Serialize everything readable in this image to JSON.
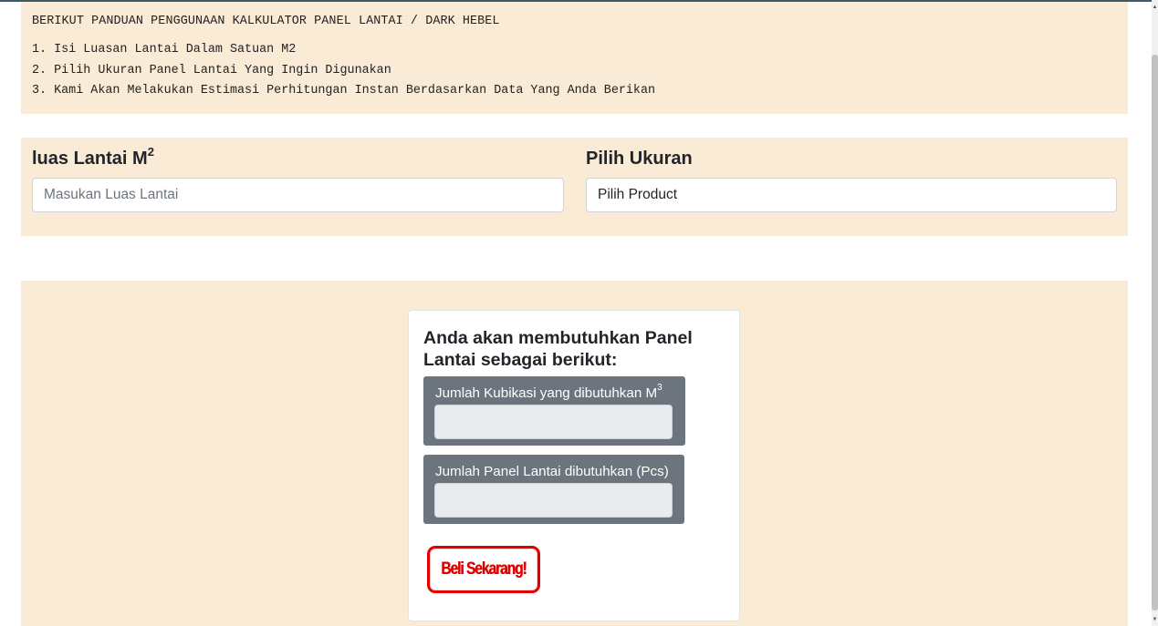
{
  "guide": {
    "title": "BERIKUT PANDUAN PENGGUNAAN KALKULATOR PANEL LANTAI / DARK HEBEL",
    "steps": [
      "1. Isi Luasan Lantai Dalam Satuan M2",
      "2. Pilih Ukuran Panel Lantai Yang Ingin Digunakan",
      "3. Kami Akan Melakukan Estimasi Perhitungan Instan Berdasarkan Data Yang Anda Berikan"
    ]
  },
  "form": {
    "area_label": "luas Lantai M",
    "area_label_sup": "2",
    "area_placeholder": "Masukan Luas Lantai",
    "area_value": "",
    "size_label": "Pilih Ukuran",
    "size_value": "Pilih Product"
  },
  "result": {
    "title": "Anda akan membutuhkan Panel Lantai sebagai berikut:",
    "volume_label": "Jumlah Kubikasi yang dibutuhkan M",
    "volume_label_sup": "3",
    "volume_value": "",
    "panels_label": "Jumlah Panel Lantai dibutuhkan (Pcs)",
    "panels_value": "",
    "buy_button": "Beli Sekarang!"
  },
  "colors": {
    "panel_bg": "#faebd7",
    "output_box_bg": "#6c757d",
    "buy_red": "#e00000"
  }
}
